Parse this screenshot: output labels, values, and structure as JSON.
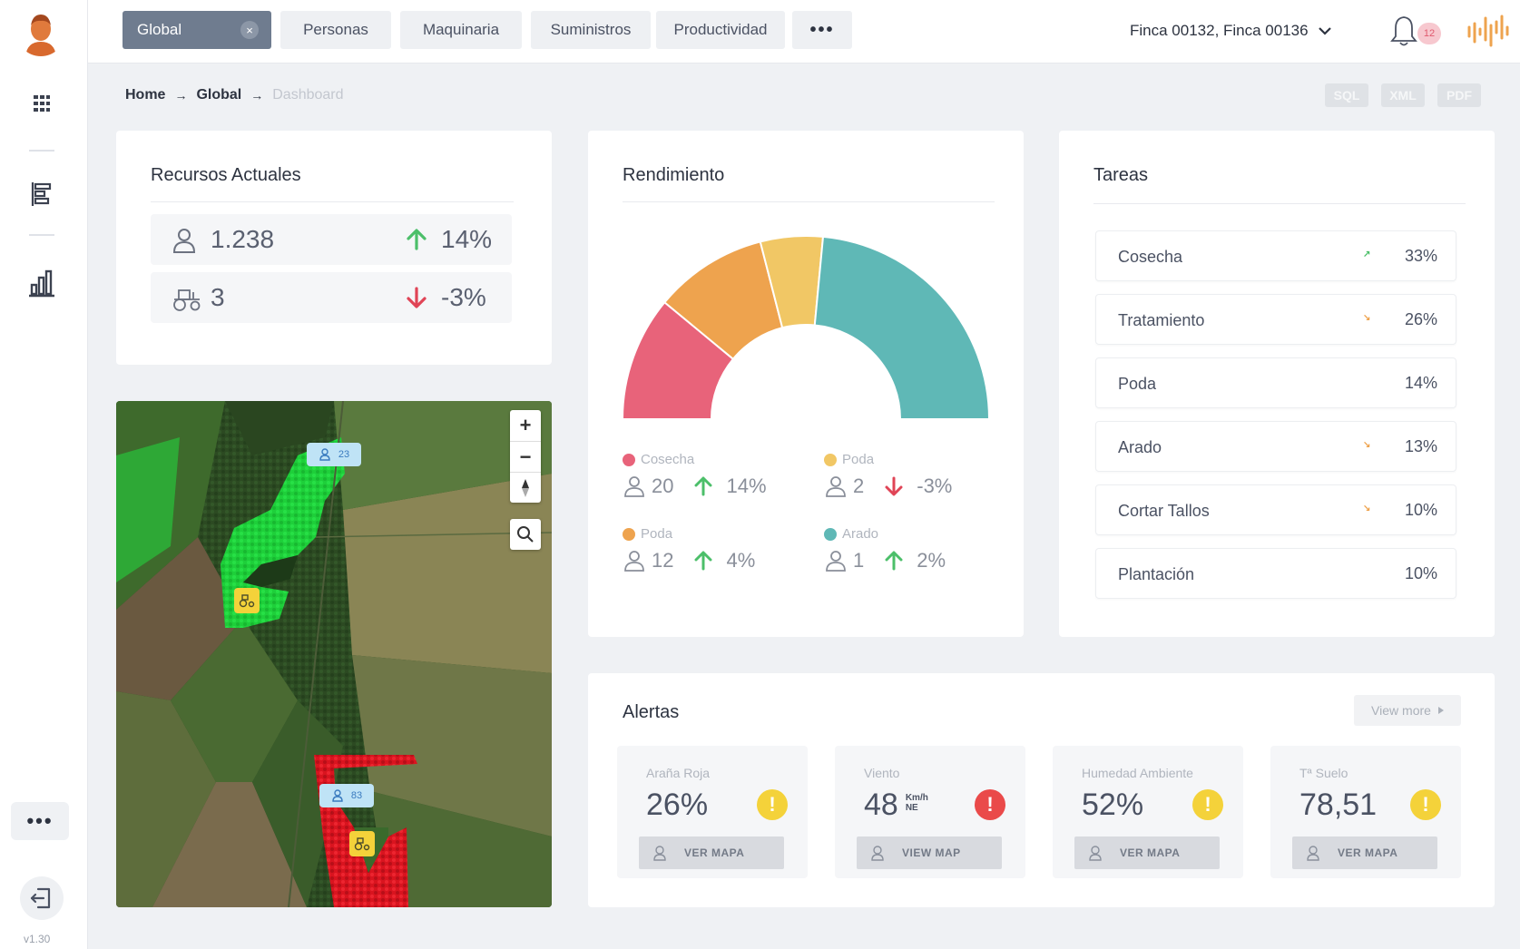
{
  "colors": {
    "cosecha": "#e8637a",
    "tratamiento": "#eea34e",
    "poda": "#f1c765",
    "arado": "#5fb8b6",
    "up": "#4cbf6a",
    "down": "#e04456",
    "warning": "#f4d23a",
    "danger": "#ea4a4a"
  },
  "sidebar": {
    "items": [
      {
        "icon": "grid-icon"
      },
      {
        "icon": "list-icon"
      },
      {
        "icon": "bar-chart-icon"
      }
    ],
    "more_label": "•••",
    "version": "v1.30"
  },
  "topbar": {
    "tabs": [
      {
        "label": "Global",
        "active": true
      },
      {
        "label": "Personas"
      },
      {
        "label": "Maquinaria"
      },
      {
        "label": "Suministros"
      },
      {
        "label": "Productividad"
      }
    ],
    "more_label": "•••",
    "close_label": "×",
    "finca_selector": "Finca 00132, Finca 00136",
    "notification_count": "12"
  },
  "breadcrumb": {
    "items": [
      "Home",
      "Global"
    ],
    "current": "Dashboard",
    "arrow": "→"
  },
  "exports": [
    "SQL",
    "XML",
    "PDF"
  ],
  "recursos": {
    "title": "Recursos Actuales",
    "rows": [
      {
        "icon": "person-icon",
        "value": "1.238",
        "trend": "up",
        "pct": "14%"
      },
      {
        "icon": "tractor-icon",
        "value": "3",
        "trend": "down",
        "pct": "-3%"
      }
    ]
  },
  "map": {
    "zoom_in": "+",
    "zoom_out": "−",
    "pins": [
      {
        "type": "person",
        "label": "23"
      },
      {
        "type": "person",
        "label": "83"
      },
      {
        "type": "tractor"
      },
      {
        "type": "tractor"
      }
    ]
  },
  "rendimiento": {
    "title": "Rendimiento",
    "legend": [
      {
        "name": "Cosecha",
        "color": "#e8637a",
        "count": "20",
        "trend": "up",
        "pct": "14%"
      },
      {
        "name": "Poda",
        "color": "#f1c765",
        "count": "2",
        "trend": "down",
        "pct": "-3%"
      },
      {
        "name": "Poda",
        "color": "#eea34e",
        "count": "12",
        "trend": "up",
        "pct": "4%"
      },
      {
        "name": "Arado",
        "color": "#5fb8b6",
        "count": "1",
        "trend": "up",
        "pct": "2%"
      }
    ]
  },
  "chart_data": {
    "type": "pie",
    "title": "Rendimiento",
    "subtype": "half-donut",
    "series": [
      {
        "color": "#e8637a",
        "value": 22
      },
      {
        "color": "#eea34e",
        "value": 20
      },
      {
        "color": "#f1c765",
        "value": 11
      },
      {
        "color": "#5fb8b6",
        "value": 47
      }
    ]
  },
  "tareas": {
    "title": "Tareas",
    "rows": [
      {
        "name": "Cosecha",
        "indicator": "up",
        "pct": "33%"
      },
      {
        "name": "Tratamiento",
        "indicator": "down",
        "pct": "26%"
      },
      {
        "name": "Poda",
        "indicator": "none",
        "pct": "14%"
      },
      {
        "name": "Arado",
        "indicator": "down",
        "pct": "13%"
      },
      {
        "name": "Cortar Tallos",
        "indicator": "down",
        "pct": "10%"
      },
      {
        "name": "Plantación",
        "indicator": "none",
        "pct": "10%"
      }
    ]
  },
  "alertas": {
    "title": "Alertas",
    "view_more": "View more",
    "items": [
      {
        "label": "Araña Roja",
        "value": "26%",
        "unit": "",
        "unit2": "",
        "level": "warning",
        "button": "VER MAPA"
      },
      {
        "label": "Viento",
        "value": "48",
        "unit": "Km/h",
        "unit2": "NE",
        "level": "danger",
        "button": "VIEW MAP"
      },
      {
        "label": "Humedad Ambiente",
        "value": "52%",
        "unit": "",
        "unit2": "",
        "level": "warning",
        "button": "VER MAPA"
      },
      {
        "label": "Tª Suelo",
        "value": "78,51",
        "unit": "",
        "unit2": "",
        "level": "warning",
        "button": "VER MAPA"
      }
    ]
  }
}
